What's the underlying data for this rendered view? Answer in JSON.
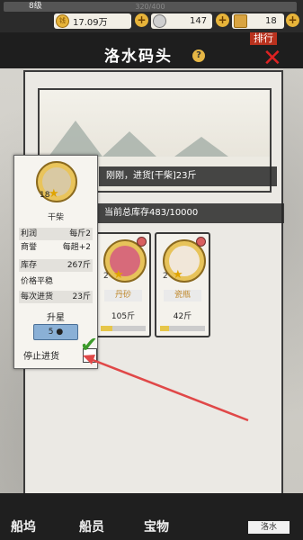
{
  "topbar": {
    "level_label": "8级",
    "xp_text": "320/400",
    "copper": "17.09万",
    "gold_silver": "147",
    "boxes": "18"
  },
  "header": {
    "title": "洛水码头",
    "rank_label": "排行"
  },
  "panel": {
    "message": "刚刚，进货[干柴]23斤",
    "stock_text": "当前总库存483/10000"
  },
  "goods": [
    {
      "level": "2",
      "name": "丹砂",
      "qty": "105斤",
      "progress": 0.25,
      "color": "#d76a7a"
    },
    {
      "level": "2",
      "name": "瓷瓶",
      "qty": "42斤",
      "progress": 0.2,
      "color": "#f1e7d9"
    }
  ],
  "tooltip": {
    "level": "18",
    "name": "干柴",
    "rows": [
      {
        "k": "利润",
        "v": "每斤2"
      },
      {
        "k": "商誉",
        "v": "每趟+2"
      },
      {
        "k": "库存",
        "v": "267斤"
      },
      {
        "k": "价格平稳",
        "v": ""
      },
      {
        "k": "每次进货",
        "v": "23斤"
      }
    ],
    "upgrade_label": "升星",
    "upgrade_cost": "5",
    "stop_label": "停止进货"
  },
  "nav": {
    "ship": "船坞",
    "crew": "船员",
    "treasure": "宝物",
    "location": "洛水"
  },
  "colors": {
    "accent": "#e6b843",
    "arrow": "#e04848",
    "check": "#3c9a2a"
  }
}
